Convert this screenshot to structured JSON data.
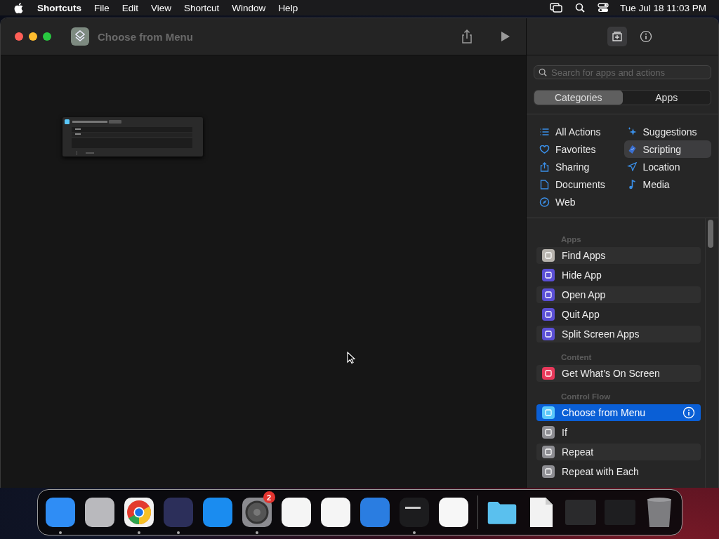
{
  "menu_bar": {
    "app_name": "Shortcuts",
    "menus": [
      "File",
      "Edit",
      "View",
      "Shortcut",
      "Window",
      "Help"
    ],
    "clock": "Tue Jul 18  11:03 PM"
  },
  "window": {
    "title": "Choose from Menu"
  },
  "sidebar": {
    "search": {
      "placeholder": "Search for apps and actions"
    },
    "segments": [
      {
        "label": "Categories",
        "selected": true
      },
      {
        "label": "Apps",
        "selected": false
      }
    ],
    "categories": [
      {
        "label": "All Actions",
        "selected": false
      },
      {
        "label": "Suggestions",
        "selected": false
      },
      {
        "label": "Favorites",
        "selected": false
      },
      {
        "label": "Scripting",
        "selected": true
      },
      {
        "label": "Sharing",
        "selected": false
      },
      {
        "label": "Location",
        "selected": false
      },
      {
        "label": "Documents",
        "selected": false
      },
      {
        "label": "Media",
        "selected": false
      },
      {
        "label": "Web",
        "selected": false
      }
    ],
    "sections": [
      {
        "title": "Apps",
        "items": [
          {
            "label": "Find Apps",
            "color": "#b8b4ae",
            "selected": false
          },
          {
            "label": "Hide App",
            "color": "#5b4fd6",
            "selected": false
          },
          {
            "label": "Open App",
            "color": "#5b4fd6",
            "selected": false
          },
          {
            "label": "Quit App",
            "color": "#5b4fd6",
            "selected": false
          },
          {
            "label": "Split Screen Apps",
            "color": "#5b4fd6",
            "selected": false
          }
        ]
      },
      {
        "title": "Content",
        "items": [
          {
            "label": "Get What’s On Screen",
            "color": "#e8385a",
            "selected": false
          }
        ]
      },
      {
        "title": "Control Flow",
        "items": [
          {
            "label": "Choose from Menu",
            "color": "#5ac8fa",
            "selected": true
          },
          {
            "label": "If",
            "color": "#8e8e93",
            "selected": false
          },
          {
            "label": "Repeat",
            "color": "#8e8e93",
            "selected": false
          },
          {
            "label": "Repeat with Each",
            "color": "#8e8e93",
            "selected": false
          }
        ]
      }
    ]
  },
  "dock": {
    "apps": [
      {
        "kind": "finder",
        "running": true
      },
      {
        "kind": "launchpad",
        "running": false
      },
      {
        "kind": "chrome",
        "running": true
      },
      {
        "kind": "shortcuts",
        "running": true
      },
      {
        "kind": "appstore",
        "running": false
      },
      {
        "kind": "settings",
        "running": true,
        "badge": "2"
      },
      {
        "kind": "textedit",
        "running": false
      },
      {
        "kind": "visualstudio",
        "running": false
      },
      {
        "kind": "weather",
        "running": false
      },
      {
        "kind": "terminal",
        "running": true
      },
      {
        "kind": "vscode",
        "running": false
      }
    ],
    "others": [
      {
        "kind": "folder"
      },
      {
        "kind": "file"
      },
      {
        "kind": "screenshot"
      },
      {
        "kind": "screenshot2"
      },
      {
        "kind": "trash"
      }
    ]
  }
}
